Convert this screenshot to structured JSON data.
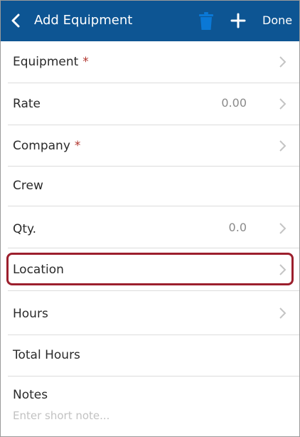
{
  "header": {
    "title": "Add Equipment",
    "done_label": "Done",
    "icons": {
      "back": "chevron-left-icon",
      "trash": "trash-icon",
      "add": "plus-icon"
    }
  },
  "rows": [
    {
      "label": "Equipment",
      "required_mark": "*",
      "value": "",
      "chevron": true
    },
    {
      "label": "Rate",
      "required_mark": "",
      "value": "0.00",
      "chevron": true
    },
    {
      "label": "Company",
      "required_mark": "*",
      "value": "",
      "chevron": true
    },
    {
      "label": "Crew",
      "required_mark": "",
      "value": "",
      "chevron": false
    },
    {
      "label": "Qty.",
      "required_mark": "",
      "value": "0.0",
      "chevron": true
    },
    {
      "label": "Location",
      "required_mark": "",
      "value": "",
      "chevron": true,
      "highlighted": true
    },
    {
      "label": "Hours",
      "required_mark": "",
      "value": "",
      "chevron": true
    },
    {
      "label": "Total Hours",
      "required_mark": "",
      "value": "",
      "chevron": false
    }
  ],
  "notes": {
    "label": "Notes",
    "placeholder": "Enter short note..."
  },
  "colors": {
    "header_bg": "#0d5593",
    "required": "#b0342c",
    "highlight_border": "#9c1f2d"
  }
}
